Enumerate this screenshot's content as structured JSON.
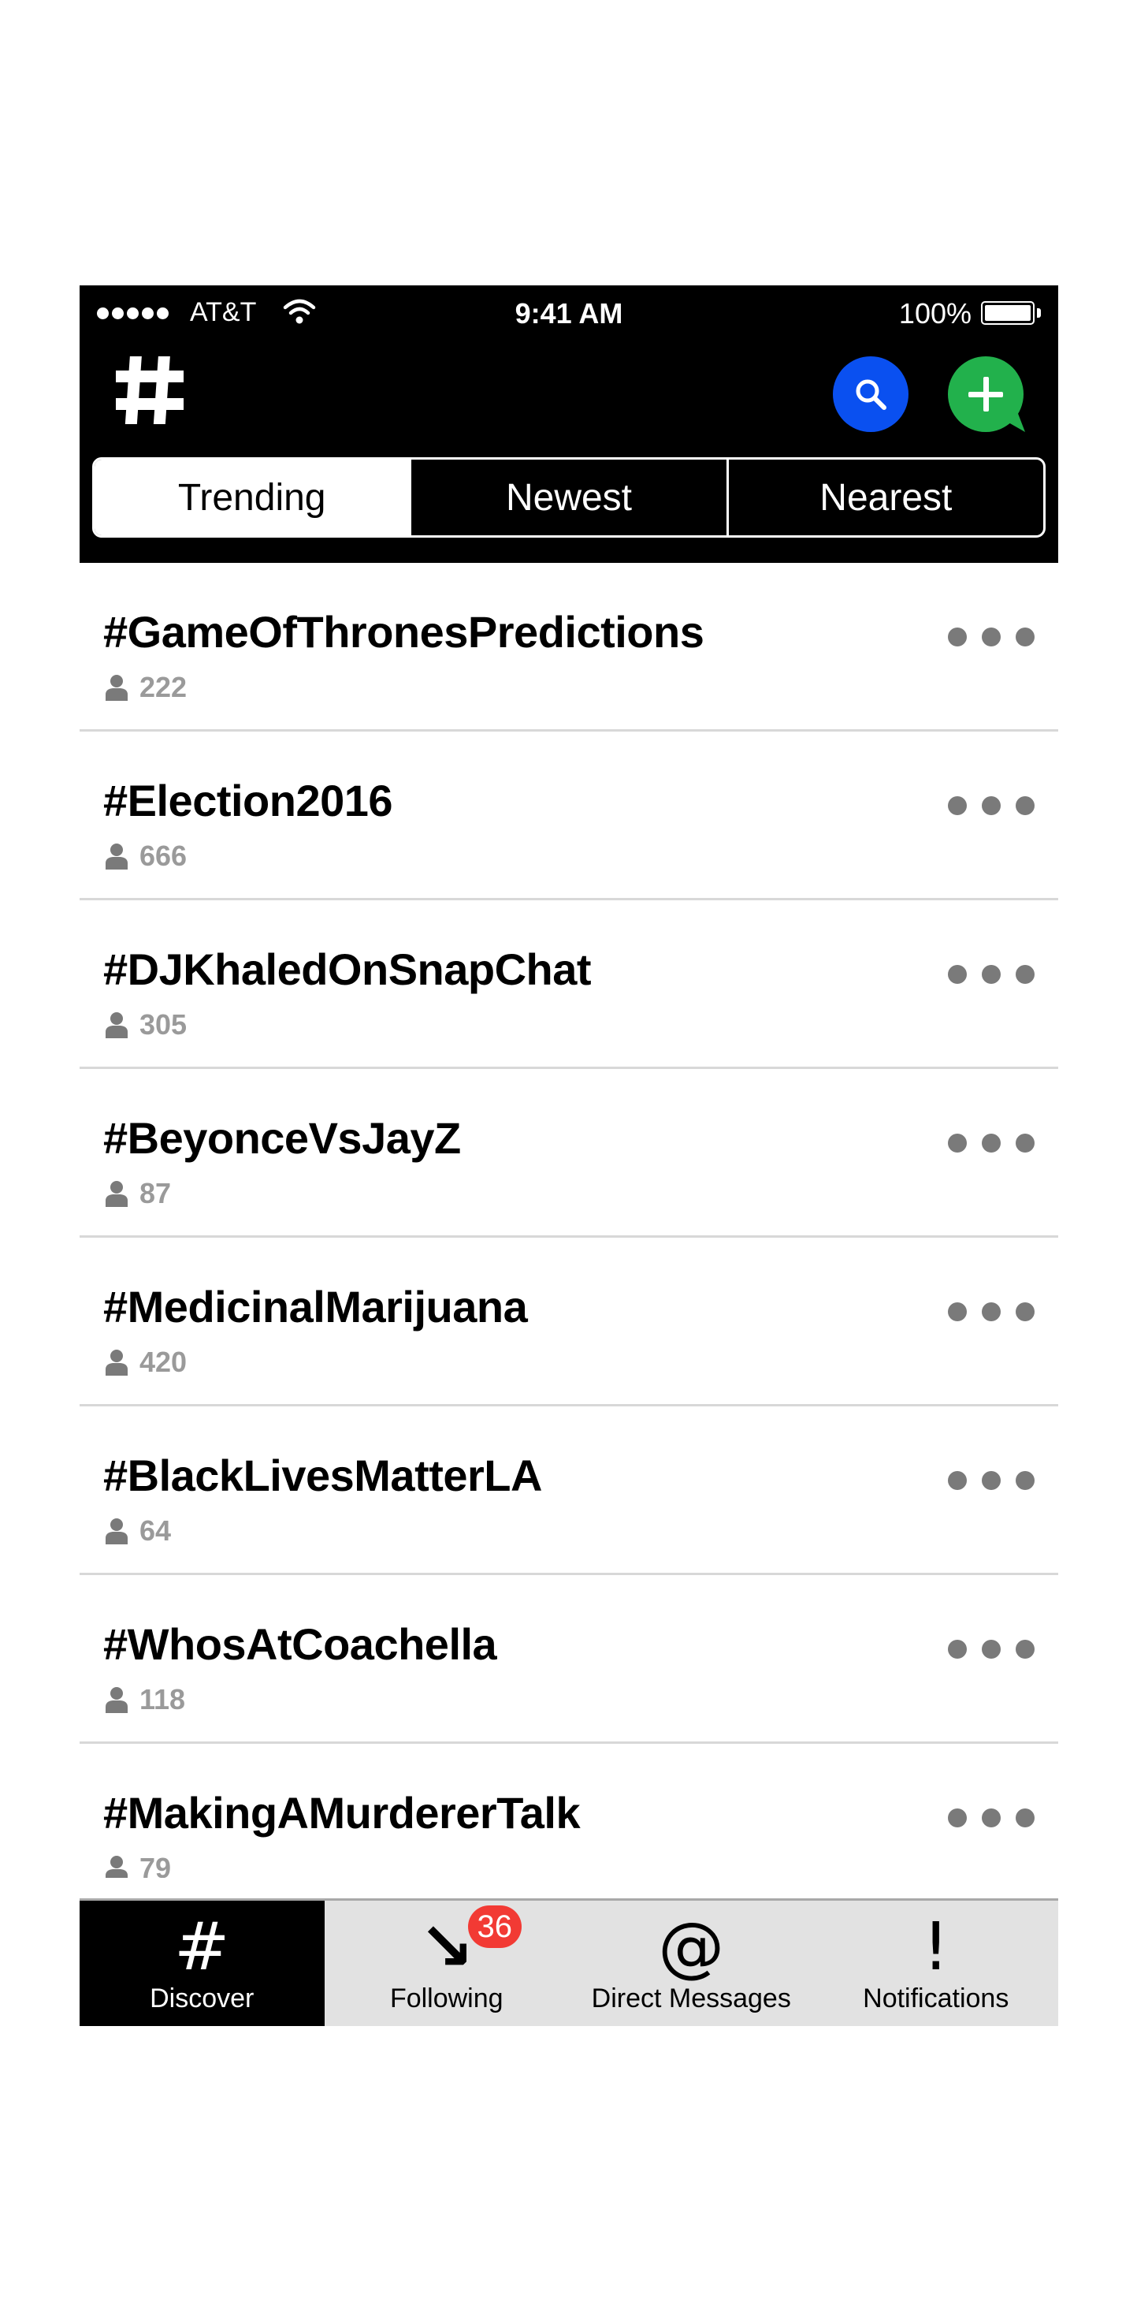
{
  "status_bar": {
    "carrier": "AT&T",
    "time": "9:41 AM",
    "battery": "100%"
  },
  "header": {
    "logo_icon": "hashtag-logo-icon",
    "search_icon": "search-icon",
    "compose_icon": "add-chat-icon",
    "colors": {
      "search": "#0a50f0",
      "compose": "#22b14c"
    }
  },
  "tabs": [
    "Trending",
    "Newest",
    "Nearest"
  ],
  "active_tab": "Trending",
  "items": [
    {
      "title": "#GameOfThronesPredictions",
      "count": "222"
    },
    {
      "title": "#Election2016",
      "count": "666"
    },
    {
      "title": "#DJKhaledOnSnapChat",
      "count": "305"
    },
    {
      "title": "#BeyonceVsJayZ",
      "count": "87"
    },
    {
      "title": "#MedicinalMarijuana",
      "count": "420"
    },
    {
      "title": "#BlackLivesMatterLA",
      "count": "64"
    },
    {
      "title": "#WhosAtCoachella",
      "count": "118"
    },
    {
      "title": "#MakingAMurdererTalk",
      "count": "79"
    }
  ],
  "tab_bar": [
    {
      "glyph": "#",
      "label": "Discover",
      "icon": "hashtag-icon"
    },
    {
      "glyph": "↘",
      "label": "Following",
      "icon": "arrow-down-right-icon",
      "badge": "36"
    },
    {
      "glyph": "@",
      "label": "Direct Messages",
      "icon": "at-sign-icon"
    },
    {
      "glyph": "!",
      "label": "Notifications",
      "icon": "exclamation-icon"
    }
  ],
  "badge_color": "#f23a34"
}
